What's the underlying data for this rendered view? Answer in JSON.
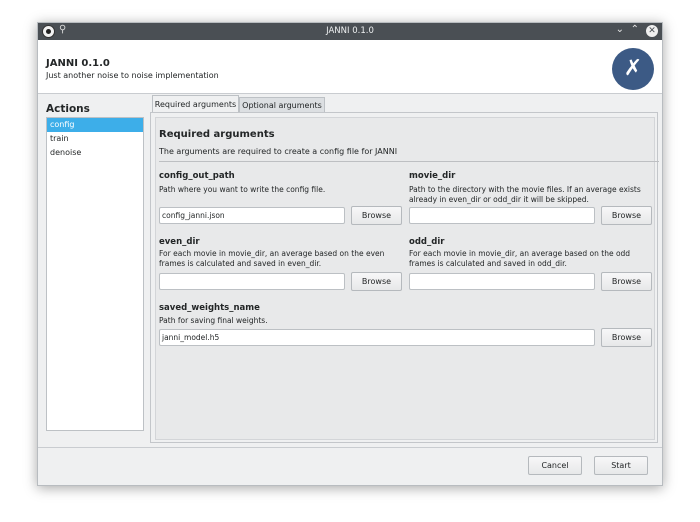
{
  "window": {
    "title": "JANNI 0.1.0"
  },
  "header": {
    "app_name": "JANNI 0.1.0",
    "subtitle": "Just another noise to noise implementation"
  },
  "sidebar": {
    "title": "Actions",
    "items": [
      {
        "label": "config"
      },
      {
        "label": "train"
      },
      {
        "label": "denoise"
      }
    ]
  },
  "tabs": [
    {
      "label": "Required arguments"
    },
    {
      "label": "Optional arguments"
    }
  ],
  "section": {
    "title": "Required arguments",
    "description": "The arguments are required to create a config file for JANNI"
  },
  "fields": [
    {
      "name": "config_out_path",
      "help": "Path where you want to write the config file.",
      "value": "config_janni.json",
      "button": "Browse"
    },
    {
      "name": "movie_dir",
      "help": "Path to the directory with the movie files. If an average exists already in even_dir or odd_dir it will be skipped.",
      "value": "",
      "button": "Browse"
    },
    {
      "name": "even_dir",
      "help": "For each movie in movie_dir, an average based on the even frames is calculated and saved in even_dir.",
      "value": "",
      "button": "Browse"
    },
    {
      "name": "odd_dir",
      "help": "For each movie in movie_dir, an average based on the odd frames is calculated and saved in odd_dir.",
      "value": "",
      "button": "Browse"
    },
    {
      "name": "saved_weights_name",
      "help": "Path for saving final weights.",
      "value": "janni_model.h5",
      "button": "Browse"
    }
  ],
  "footer": {
    "cancel": "Cancel",
    "start": "Start"
  },
  "colors": {
    "accent": "#3daee9",
    "titlebar": "#4a4f54",
    "logo_bg": "#3c5a85"
  },
  "icons": {
    "app": "panda-icon",
    "pin": "pin-icon",
    "minimize": "chevron-down-icon",
    "maximize": "chevron-up-icon",
    "close": "close-icon",
    "logo": "tools-icon"
  }
}
